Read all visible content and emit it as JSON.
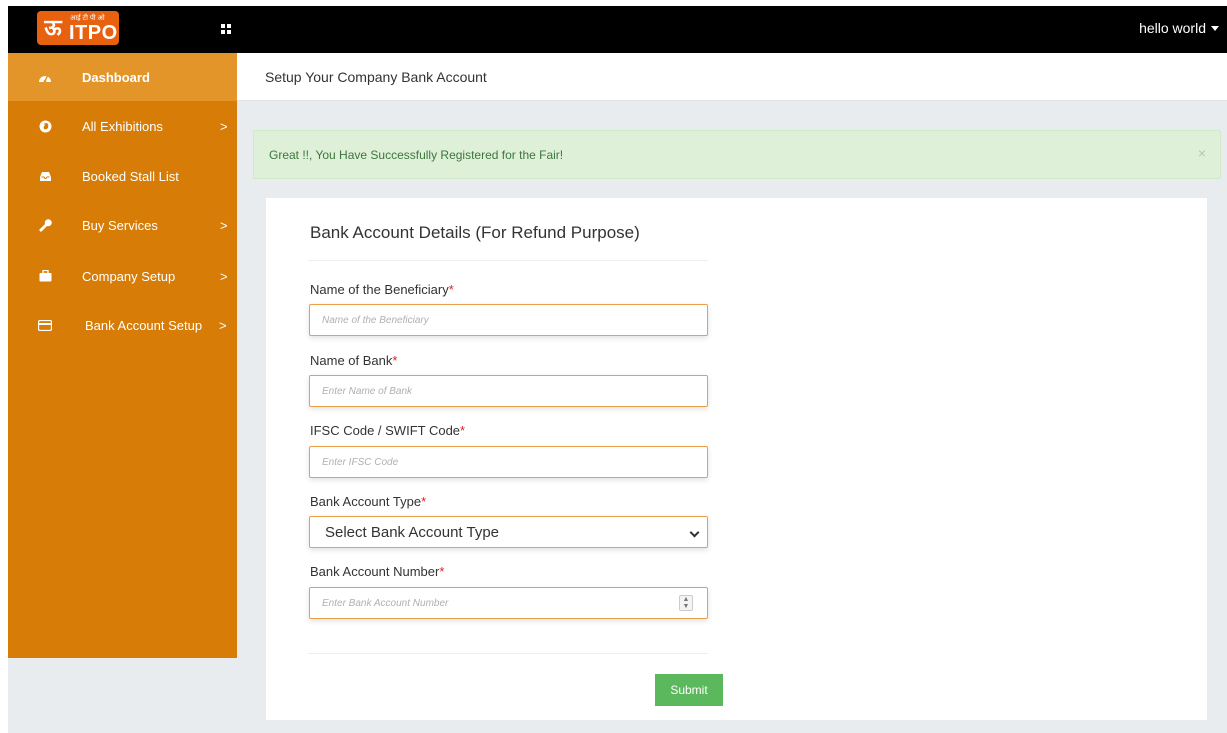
{
  "brand": {
    "logo_hindi": "आई टी पी ओ",
    "logo_text": "ITPO"
  },
  "header": {
    "user_name": "hello world"
  },
  "sidebar": {
    "items": [
      {
        "label": "Dashboard",
        "icon": "dashboard-icon",
        "chevron": ""
      },
      {
        "label": "All Exhibitions",
        "icon": "globe-icon",
        "chevron": ">"
      },
      {
        "label": "Booked Stall List",
        "icon": "inbox-icon",
        "chevron": ""
      },
      {
        "label": "Buy Services",
        "icon": "wrench-icon",
        "chevron": ">"
      },
      {
        "label": "Company Setup",
        "icon": "briefcase-icon",
        "chevron": ">"
      },
      {
        "label": "Bank Account Setup",
        "icon": "credit-card-icon",
        "chevron": ">"
      }
    ]
  },
  "page": {
    "title": "Setup Your Company Bank Account"
  },
  "alert": {
    "message": "Great !!, You Have Successfully Registered for the Fair!",
    "close": "×"
  },
  "form": {
    "title": "Bank Account Details (For Refund Purpose)",
    "required_mark": "*",
    "beneficiary": {
      "label": "Name of the Beneficiary",
      "placeholder": "Name of the Beneficiary",
      "value": ""
    },
    "bank_name": {
      "label": "Name of Bank",
      "placeholder": "Enter Name of Bank",
      "value": ""
    },
    "ifsc": {
      "label": "IFSC Code / SWIFT Code",
      "placeholder": "Enter IFSC Code",
      "value": ""
    },
    "account_type": {
      "label": "Bank Account Type",
      "selected": "Select Bank Account Type"
    },
    "account_number": {
      "label": "Bank Account Number",
      "placeholder": "Enter Bank Account Number",
      "value": ""
    },
    "submit_label": "Submit"
  },
  "colors": {
    "sidebar": "#d67c07",
    "sidebar_active": "#e3952a",
    "topbar": "#000000",
    "alert_bg": "#dff0d8",
    "submit": "#5cb85c",
    "input_border": "#e8a04b"
  }
}
